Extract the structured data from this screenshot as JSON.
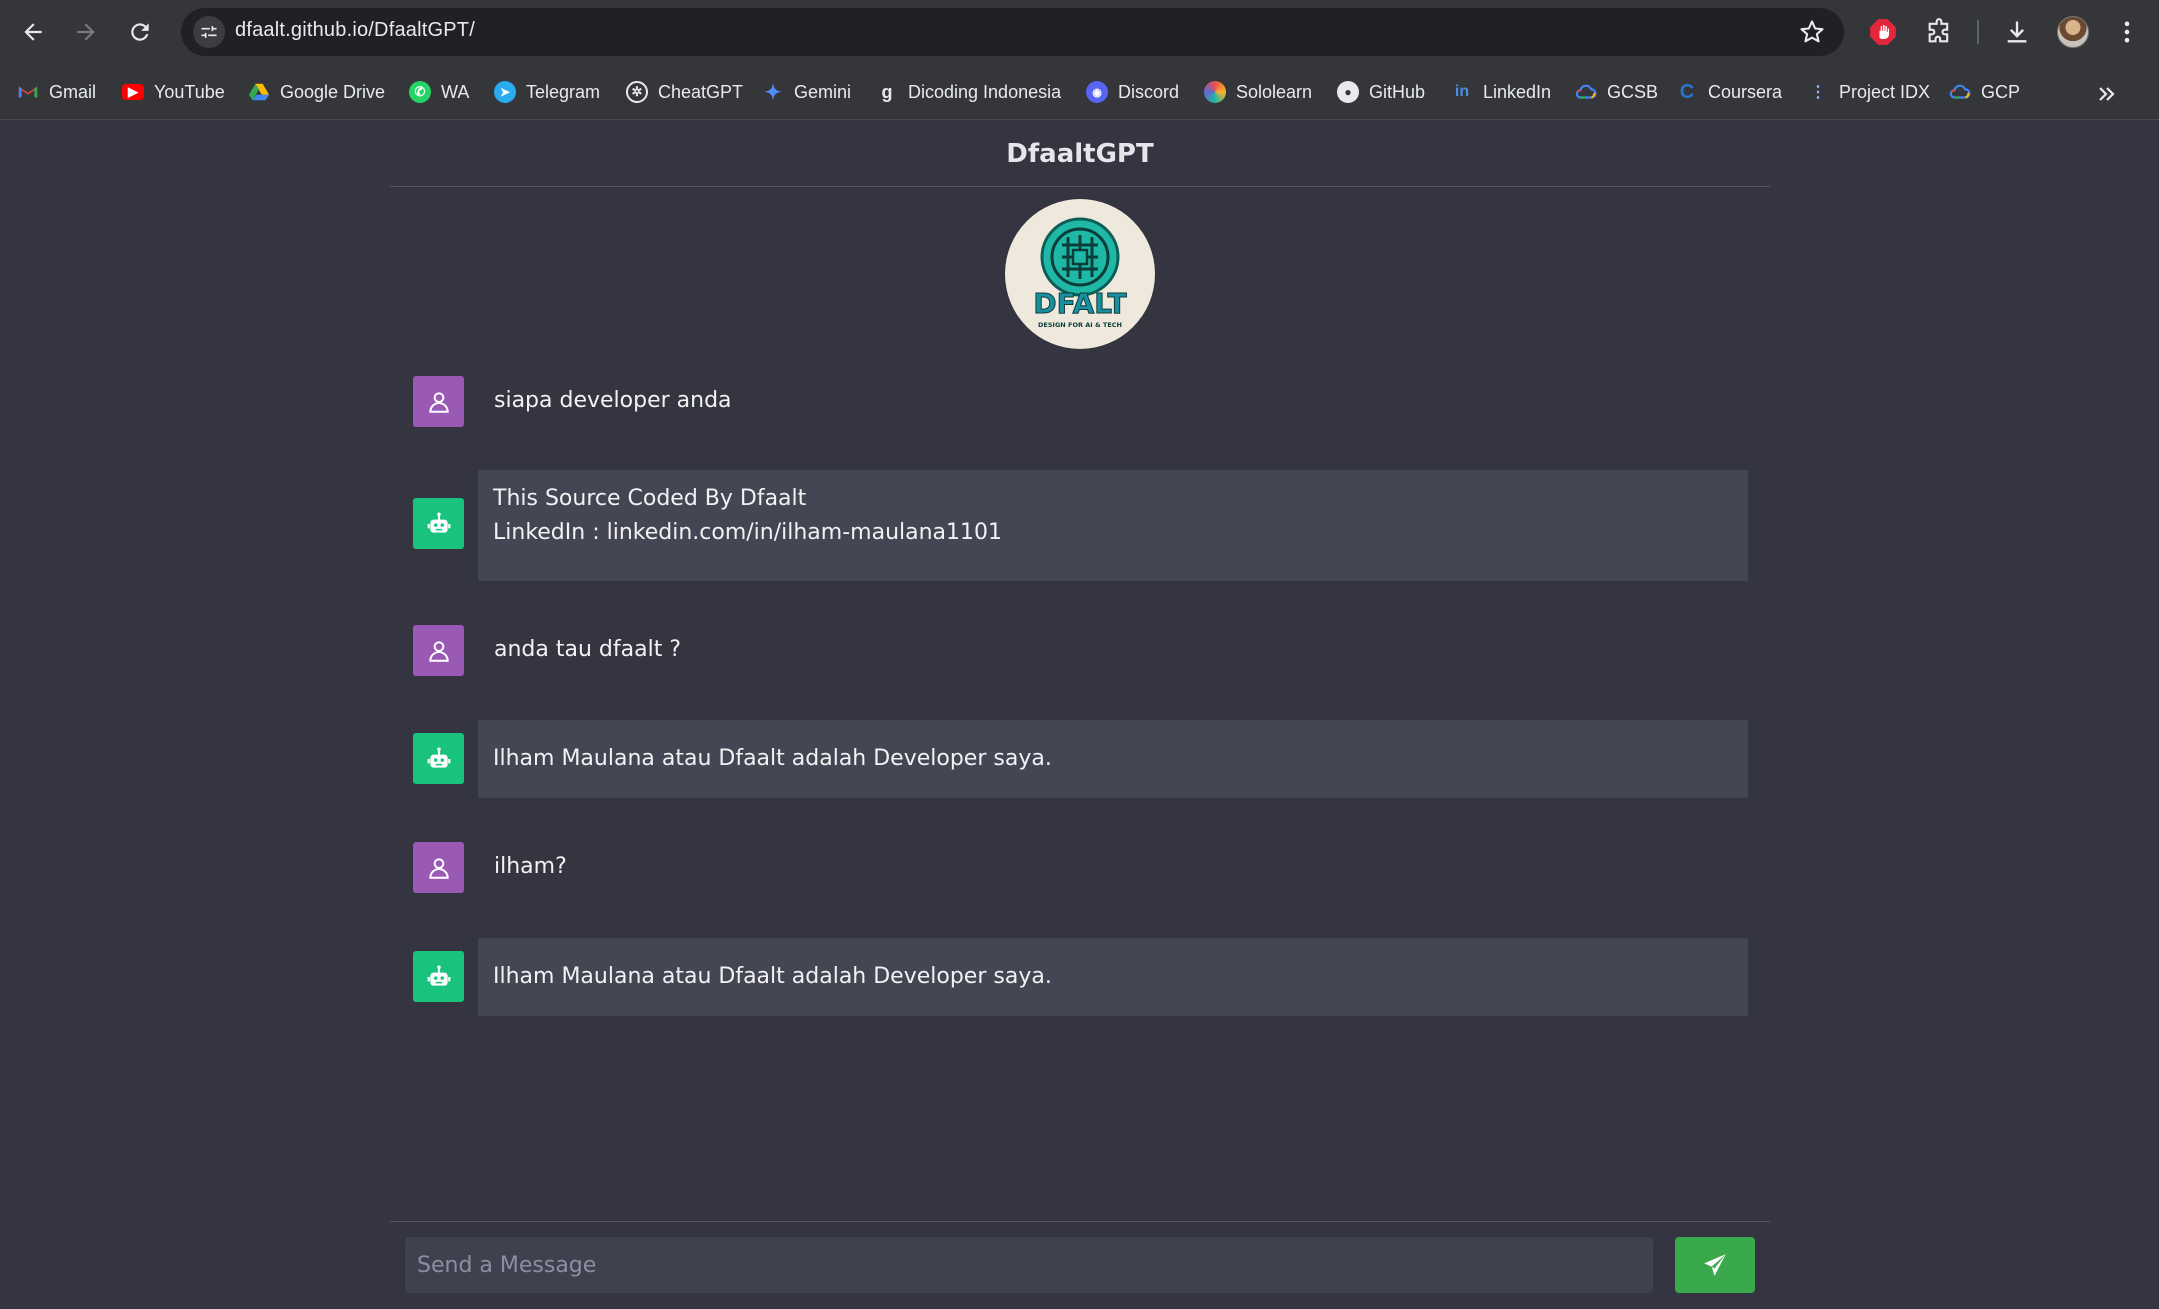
{
  "browser": {
    "url": "dfaalt.github.io/DfaaltGPT/",
    "bookmarks": [
      {
        "label": "Gmail",
        "icon": "gmail-icon",
        "color": "#ea4335"
      },
      {
        "label": "YouTube",
        "icon": "youtube-icon",
        "color": "#ff0000"
      },
      {
        "label": "Google Drive",
        "icon": "google-drive-icon",
        "color": "#fbbc04"
      },
      {
        "label": "WA",
        "icon": "whatsapp-icon",
        "color": "#25d366"
      },
      {
        "label": "Telegram",
        "icon": "telegram-icon",
        "color": "#2aabee"
      },
      {
        "label": "CheatGPT",
        "icon": "openai-icon",
        "color": "#ffffff"
      },
      {
        "label": "Gemini",
        "icon": "gemini-icon",
        "color": "#4f8ef7"
      },
      {
        "label": "Dicoding Indonesia",
        "icon": "dicoding-icon",
        "color": "#ffffff"
      },
      {
        "label": "Discord",
        "icon": "discord-icon",
        "color": "#5865f2"
      },
      {
        "label": "Sololearn",
        "icon": "sololearn-icon",
        "color": "#e8504b"
      },
      {
        "label": "GitHub",
        "icon": "github-icon",
        "color": "#ffffff"
      },
      {
        "label": "LinkedIn",
        "icon": "linkedin-icon",
        "color": "#4a90e2"
      },
      {
        "label": "GCSB",
        "icon": "google-cloud-icon",
        "color": "#f4b400"
      },
      {
        "label": "Coursera",
        "icon": "coursera-icon",
        "color": "#2a73cc"
      },
      {
        "label": "Project IDX",
        "icon": "project-idx-icon",
        "color": "#8ab4f8"
      },
      {
        "label": "GCP",
        "icon": "google-cloud-icon",
        "color": "#f4b400"
      }
    ]
  },
  "app": {
    "title": "DfaaltGPT",
    "logo": {
      "text": "DFALT",
      "subtext": "DESIGN FOR AI & TECH",
      "accent": "#1fb8a6"
    }
  },
  "messages": [
    {
      "role": "user",
      "lines": [
        "siapa developer anda"
      ]
    },
    {
      "role": "bot",
      "lines": [
        "This Source Coded By Dfaalt",
        "LinkedIn : linkedin.com/in/ilham-maulana1101"
      ]
    },
    {
      "role": "user",
      "lines": [
        "anda tau dfaalt ?"
      ]
    },
    {
      "role": "bot",
      "lines": [
        "Ilham Maulana atau Dfaalt adalah Developer saya."
      ]
    },
    {
      "role": "user",
      "lines": [
        "ilham?"
      ]
    },
    {
      "role": "bot",
      "lines": [
        "Ilham Maulana atau Dfaalt adalah Developer saya."
      ]
    }
  ],
  "composer": {
    "placeholder": "Send a Message",
    "value": ""
  },
  "colors": {
    "user_avatar": "#9b59b6",
    "bot_avatar": "#19c37d",
    "send_button": "#3aa94c"
  }
}
